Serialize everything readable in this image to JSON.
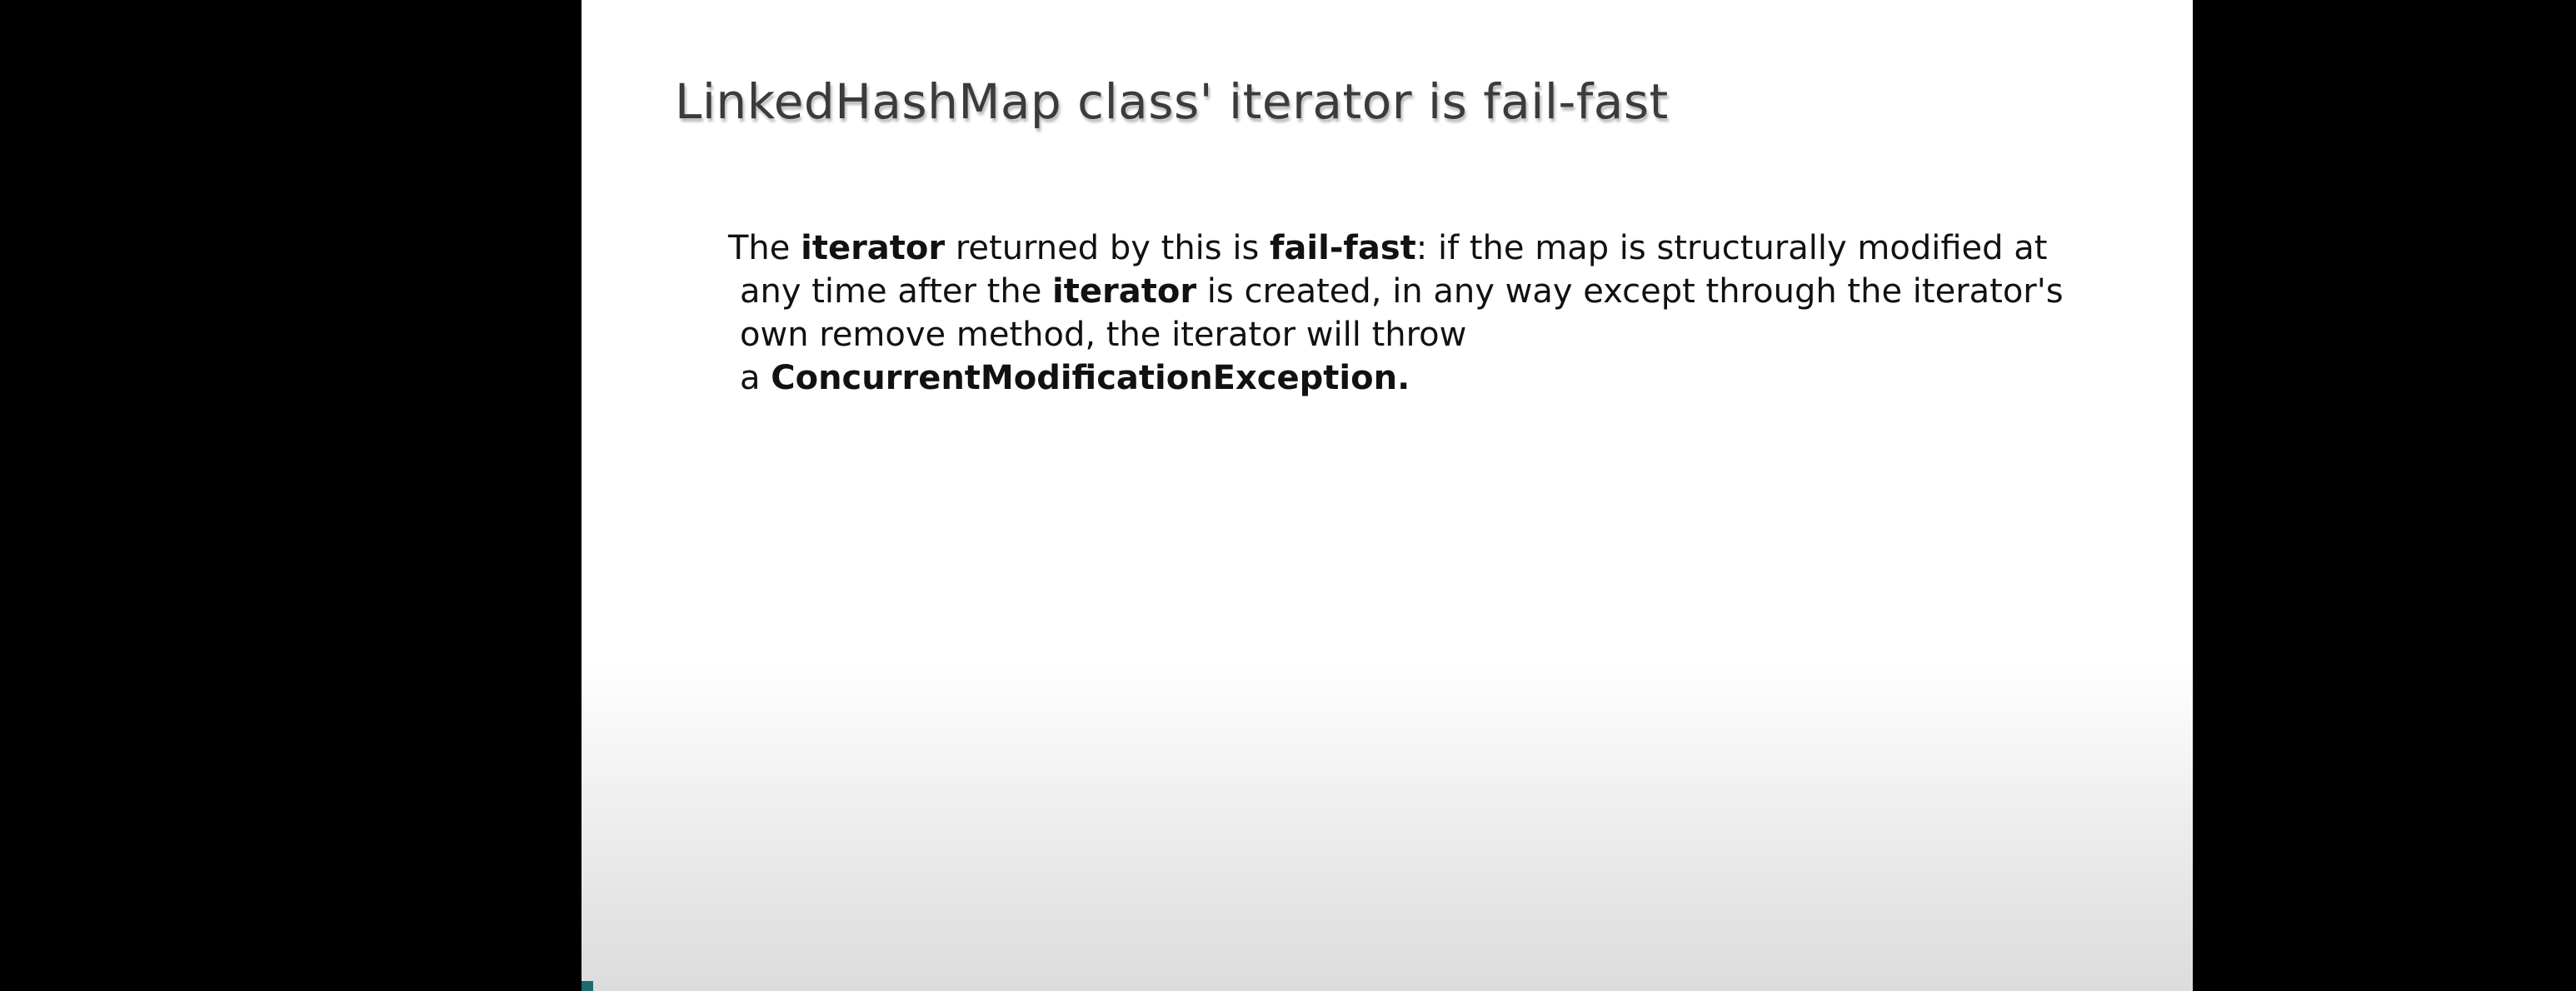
{
  "slide": {
    "title": "LinkedHashMap class' iterator is fail-fast",
    "body": {
      "line1": {
        "w1": "The ",
        "b1": "iterator",
        "w2": " returned by this  is ",
        "b2": "fail-fast",
        "w3": ": if the map is structurally modified at"
      },
      "line2": {
        "w1": "any time after the ",
        "b1": "iterator",
        "w2": " is created, in any way except through the iterator's"
      },
      "line3": {
        "w1": "own remove method, the iterator will throw"
      },
      "line4": {
        "w1": "a ",
        "b1": "ConcurrentModificationException."
      }
    }
  },
  "colors": {
    "letterbox": "#000000",
    "slide_background": "#ffffff",
    "title_text": "#3b3b3b",
    "body_text": "#111111"
  }
}
